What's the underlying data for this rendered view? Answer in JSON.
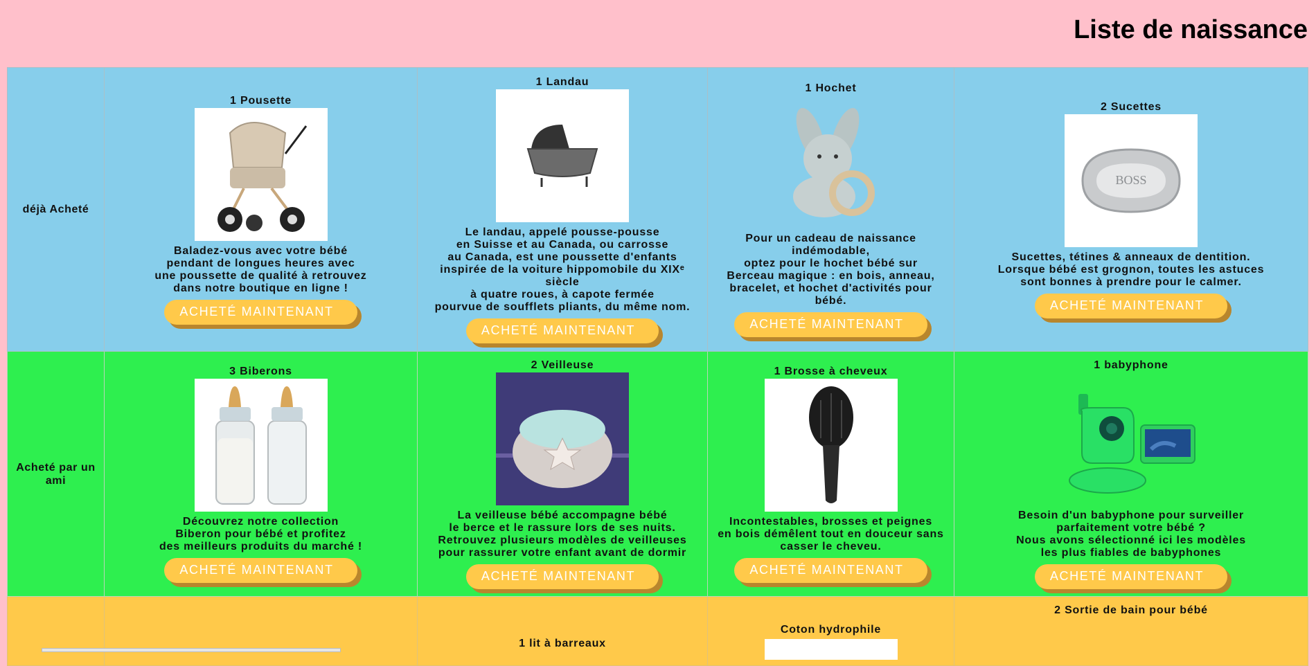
{
  "page": {
    "title": "Liste de naissance"
  },
  "rows": {
    "bought": {
      "label": "déjà Acheté"
    },
    "friend": {
      "label": "Acheté par un ami"
    }
  },
  "button_label": "ACHETÉ MAINTENANT",
  "products": {
    "poussette": {
      "name": "1 Pousette",
      "desc": "Baladez-vous avec votre bébé\npendant de longues heures avec\nune poussette de qualité à retrouvez\ndans notre boutique en ligne !"
    },
    "landau": {
      "name": "1 Landau",
      "desc": "Le landau, appelé pousse-pousse\nen Suisse et au Canada, ou carrosse\nau Canada, est une poussette d'enfants\ninspirée de la voiture hippomobile du XIXᵉ siècle\nà quatre roues, à capote fermée\npourvue de soufflets pliants, du même nom."
    },
    "hochet": {
      "name": "1 Hochet",
      "desc": "Pour un cadeau de naissance indémodable,\noptez pour le hochet bébé sur\nBerceau magique : en bois, anneau,\nbracelet, et hochet d'activités pour bébé."
    },
    "sucettes": {
      "name": "2 Sucettes",
      "desc": "Sucettes, tétines & anneaux de dentition.\nLorsque bébé est grognon, toutes les astuces\nsont bonnes à prendre pour le calmer.",
      "logo_text": "BOSS"
    },
    "biberons": {
      "name": "3 Biberons",
      "desc": "Découvrez notre collection\nBiberon pour bébé et profitez\ndes meilleurs produits du marché !"
    },
    "veilleuse": {
      "name": "2 Veilleuse",
      "desc": "La veilleuse bébé accompagne bébé\nle berce et le rassure lors de ses nuits.\nRetrouvez plusieurs modèles de veilleuses\npour rassurer votre enfant avant de dormir"
    },
    "brosse": {
      "name": "1 Brosse à cheveux",
      "desc": "Incontestables, brosses et peignes\nen bois démêlent tout en douceur sans\ncasser le cheveu."
    },
    "babyphone": {
      "name": "1 babyphone",
      "desc": "Besoin d'un babyphone pour surveiller\nparfaitement votre bébé ?\nNous avons sélectionné ici les modèles\nles plus fiables de babyphones"
    },
    "lit": {
      "name": "1 lit à barreaux"
    },
    "coton": {
      "name": "Coton hydrophile"
    },
    "sortie_bain": {
      "name": "2 Sortie de bain pour bébé"
    }
  },
  "colors": {
    "page_bg": "#ffc0cb",
    "row_bought": "#87ceeb",
    "row_friend": "#2eef4f",
    "row_wishlist": "#ffc94a",
    "button_bg": "#ffc94a",
    "button_shadow": "#b8862d"
  }
}
